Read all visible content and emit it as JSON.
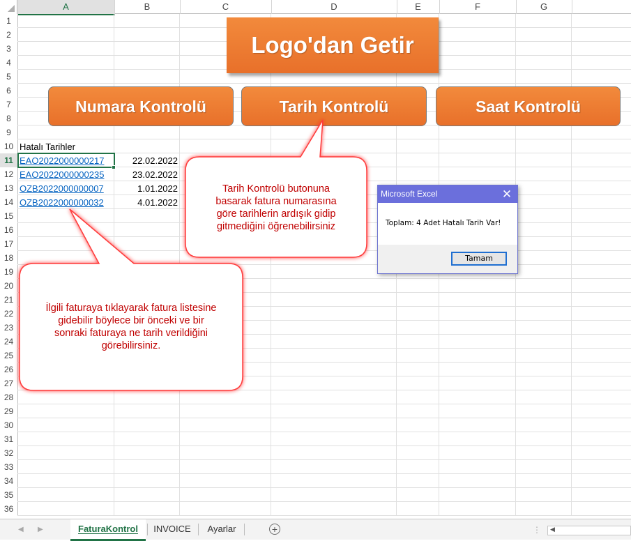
{
  "columns": [
    "A",
    "B",
    "C",
    "D",
    "E",
    "F",
    "G"
  ],
  "rows": [
    "1",
    "2",
    "3",
    "4",
    "5",
    "6",
    "7",
    "8",
    "9",
    "10",
    "11",
    "12",
    "13",
    "14",
    "15",
    "16",
    "17",
    "18",
    "19",
    "20",
    "21",
    "22",
    "23",
    "24",
    "25",
    "26",
    "27",
    "28",
    "29",
    "30",
    "31",
    "32",
    "33",
    "34",
    "35",
    "36"
  ],
  "cells": {
    "header": "Hatalı Tarihler",
    "invoices": [
      {
        "number": "EAO2022000000217",
        "date": "22.02.2022"
      },
      {
        "number": "EAO2022000000235",
        "date": "23.02.2022"
      },
      {
        "number": "OZB2022000000007",
        "date": "1.01.2022"
      },
      {
        "number": "OZB2022000000032",
        "date": "4.01.2022"
      }
    ]
  },
  "buttons": {
    "logo": "Logo'dan Getir",
    "numara": "Numara Kontrolü",
    "tarih": "Tarih Kontrolü",
    "saat": "Saat Kontrolü"
  },
  "callouts": {
    "tarih_help": [
      "Tarih Kontrolü butonuna",
      "basarak fatura numarasına",
      "göre tarihlerin ardışık gidip",
      "gitmediğini öğrenebilirsiniz"
    ],
    "invoice_help": [
      "İlgili faturaya tıklayarak fatura listesine",
      "gidebilir böylece bir önceki ve bir",
      "sonraki faturaya ne tarih verildiğini",
      "görebilirsiniz."
    ]
  },
  "dialog": {
    "title": "Microsoft Excel",
    "close": "✕",
    "message": "Toplam: 4 Adet Hatalı Tarih Var!",
    "ok_label": "Tamam"
  },
  "sheet_tabs": [
    {
      "label": "FaturaKontrol",
      "active": true
    },
    {
      "label": "INVOICE",
      "active": false
    },
    {
      "label": "Ayarlar",
      "active": false
    }
  ],
  "selected": {
    "column": "A",
    "row": "11"
  },
  "colors": {
    "button_orange": "#ed7d31",
    "excel_green": "#217346",
    "link_blue": "#0563c1",
    "callout_red": "#c00000",
    "dialog_title": "#6b6fdc"
  }
}
